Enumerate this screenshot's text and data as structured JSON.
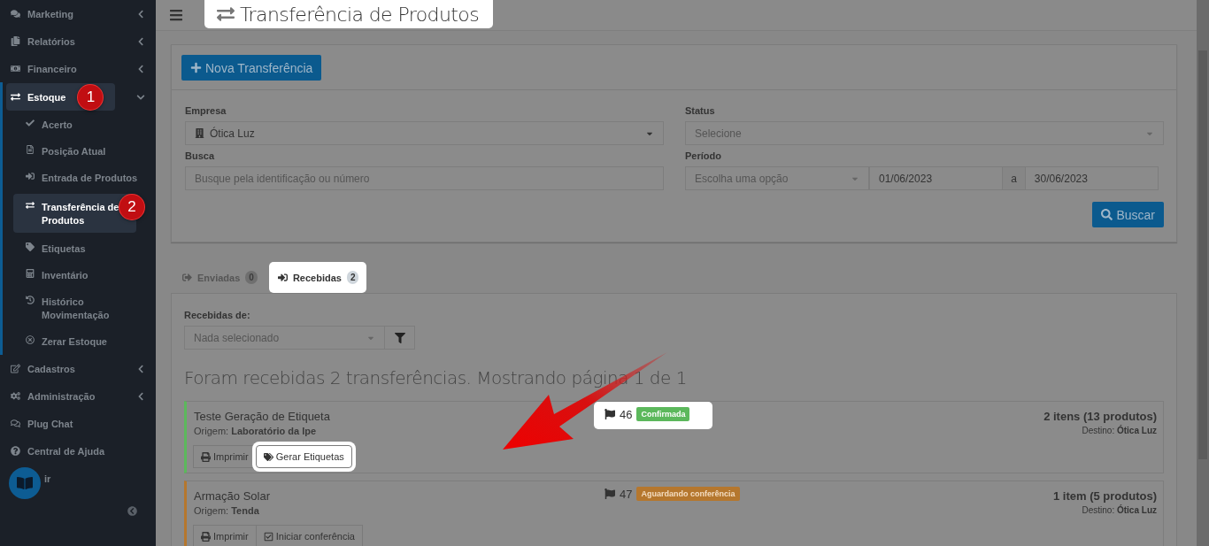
{
  "sidebar": {
    "items": [
      {
        "label": "Marketing",
        "expanded": false
      },
      {
        "label": "Relatórios",
        "expanded": false
      },
      {
        "label": "Financeiro",
        "expanded": false
      },
      {
        "label": "Estoque",
        "expanded": true,
        "selected": true,
        "children": [
          {
            "label": "Acerto",
            "selected": false
          },
          {
            "label": "Posição Atual",
            "selected": false
          },
          {
            "label": "Entrada de Produtos",
            "selected": false
          },
          {
            "label": "Transferência de Produtos",
            "selected": true
          },
          {
            "label": "Etiquetas",
            "selected": false
          },
          {
            "label": "Inventário",
            "selected": false
          },
          {
            "label": "Histórico Movimentação",
            "selected": false
          },
          {
            "label": "Zerar Estoque",
            "selected": false
          }
        ]
      },
      {
        "label": "Cadastros",
        "expanded": false
      },
      {
        "label": "Administração",
        "expanded": false
      },
      {
        "label": "Plug Chat"
      },
      {
        "label": "Central de Ajuda"
      },
      {
        "label": "ir"
      }
    ]
  },
  "callouts": [
    {
      "number": "1"
    },
    {
      "number": "2"
    }
  ],
  "page_title": {
    "text": "Transferência de Produtos",
    "highlighted": true
  },
  "filters": {
    "new_button": "Nova Transferência",
    "empresa": {
      "label": "Empresa",
      "value": "Ótica Luz"
    },
    "status": {
      "label": "Status",
      "placeholder": "Selecione"
    },
    "busca": {
      "label": "Busca",
      "placeholder": "Busque pela identificação ou número"
    },
    "periodo": {
      "label": "Período",
      "option_placeholder": "Escolha uma opção",
      "from": "01/06/2023",
      "separator": "a",
      "to": "30/06/2023"
    },
    "search_button": "Buscar"
  },
  "tabs": [
    {
      "label": "Enviadas",
      "count": "0",
      "selected": false,
      "highlighted": false
    },
    {
      "label": "Recebidas",
      "count": "2",
      "selected": true,
      "highlighted": true
    }
  ],
  "received_from": {
    "label": "Recebidas de:",
    "placeholder": "Nada selecionado"
  },
  "result_heading": "Foram recebidas 2 transferências. Mostrando página 1 de 1",
  "transfers": [
    {
      "title": "Teste Geração de Etiqueta",
      "origin": "Origem: **Laboratório da Ipe**",
      "number": "46",
      "status": "Confirmada",
      "color": "#5cb85c",
      "highlighted": true,
      "summary": "2 itens (13 produtos)",
      "destination": "Destino: **Ótica Luz**",
      "actions": [
        {
          "label": "Imprimir",
          "kind": "print",
          "highlighted": false
        },
        {
          "label": "Gerar Etiquetas",
          "kind": "tags",
          "highlighted": true
        }
      ]
    },
    {
      "title": "Armação Solar",
      "origin": "Origem: **Tenda**",
      "number": "47",
      "status": "Aguardando conferência",
      "color": "#b5772e",
      "highlighted": false,
      "summary": "1 item (5 produtos)",
      "destination": "Destino: **Ótica Luz**",
      "actions": [
        {
          "label": "Imprimir",
          "kind": "print",
          "highlighted": false
        },
        {
          "label": "Iniciar conferência",
          "kind": "check",
          "highlighted": false
        }
      ]
    }
  ]
}
